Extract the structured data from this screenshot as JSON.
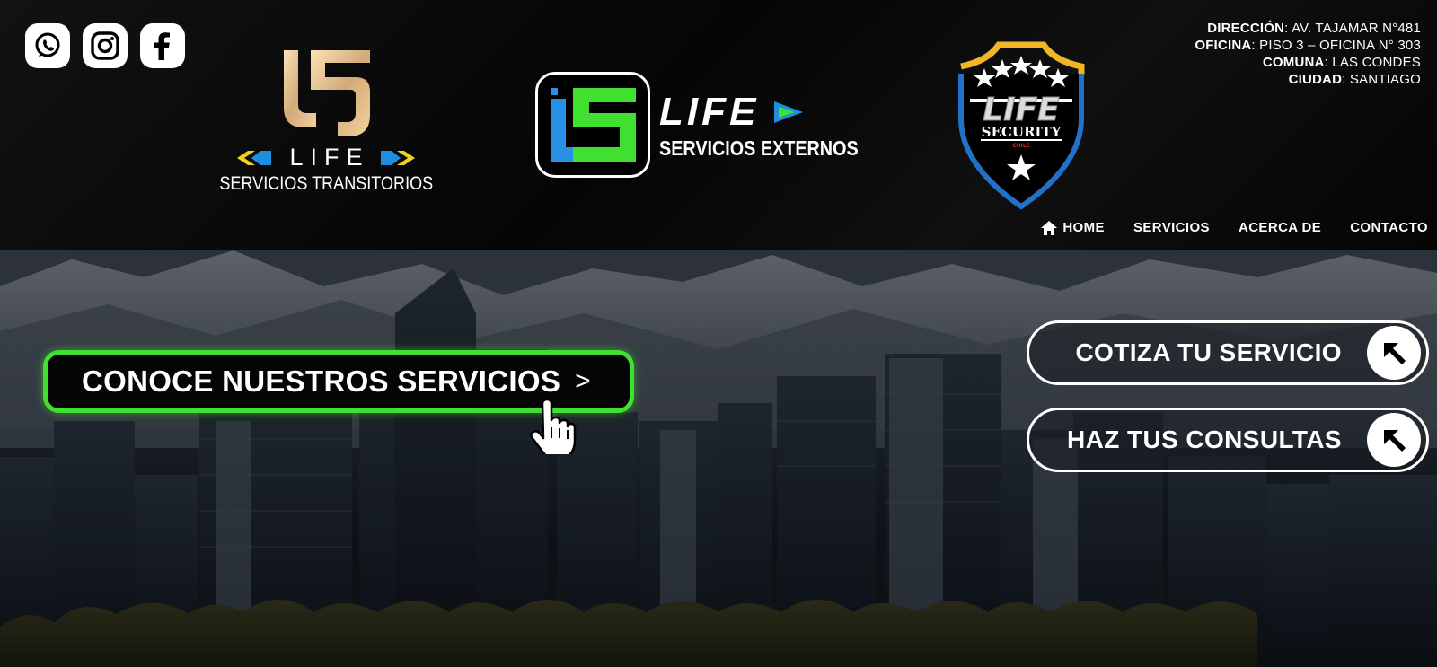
{
  "social": {
    "icons": [
      "whatsapp-icon",
      "instagram-icon",
      "facebook-icon"
    ]
  },
  "logos": {
    "transitorios": {
      "brand": "LIFE",
      "subtitle": "SERVICIOS TRANSITORIOS"
    },
    "externos": {
      "brand": "LIFE",
      "subtitle": "SERVICIOS EXTERNOS"
    },
    "security": {
      "brand": "LIFE",
      "name": "SECURITY",
      "country": "CHILE"
    }
  },
  "address": {
    "direccion_label": "DIRECCIÓN",
    "direccion_value": "AV. TAJAMAR N°481",
    "oficina_label": "OFICINA",
    "oficina_value": "PISO 3 – OFICINA N° 303",
    "comuna_label": "COMUNA",
    "comuna_value": "LAS CONDES",
    "ciudad_label": "CIUDAD",
    "ciudad_value": "SANTIAGO"
  },
  "nav": {
    "home": "HOME",
    "servicios": "SERVICIOS",
    "acerca": "ACERCA DE",
    "contacto": "CONTACTO"
  },
  "hero": {
    "main_cta": "CONOCE NUESTROS SERVICIOS",
    "main_cta_chevron": ">",
    "cotiza": "COTIZA TU SERVICIO",
    "consultas": "HAZ TUS CONSULTAS"
  },
  "colors": {
    "accent_green": "#3fe030",
    "accent_blue": "#2a90e6",
    "accent_yellow": "#f2d21c",
    "gold": "#d6b27a"
  }
}
